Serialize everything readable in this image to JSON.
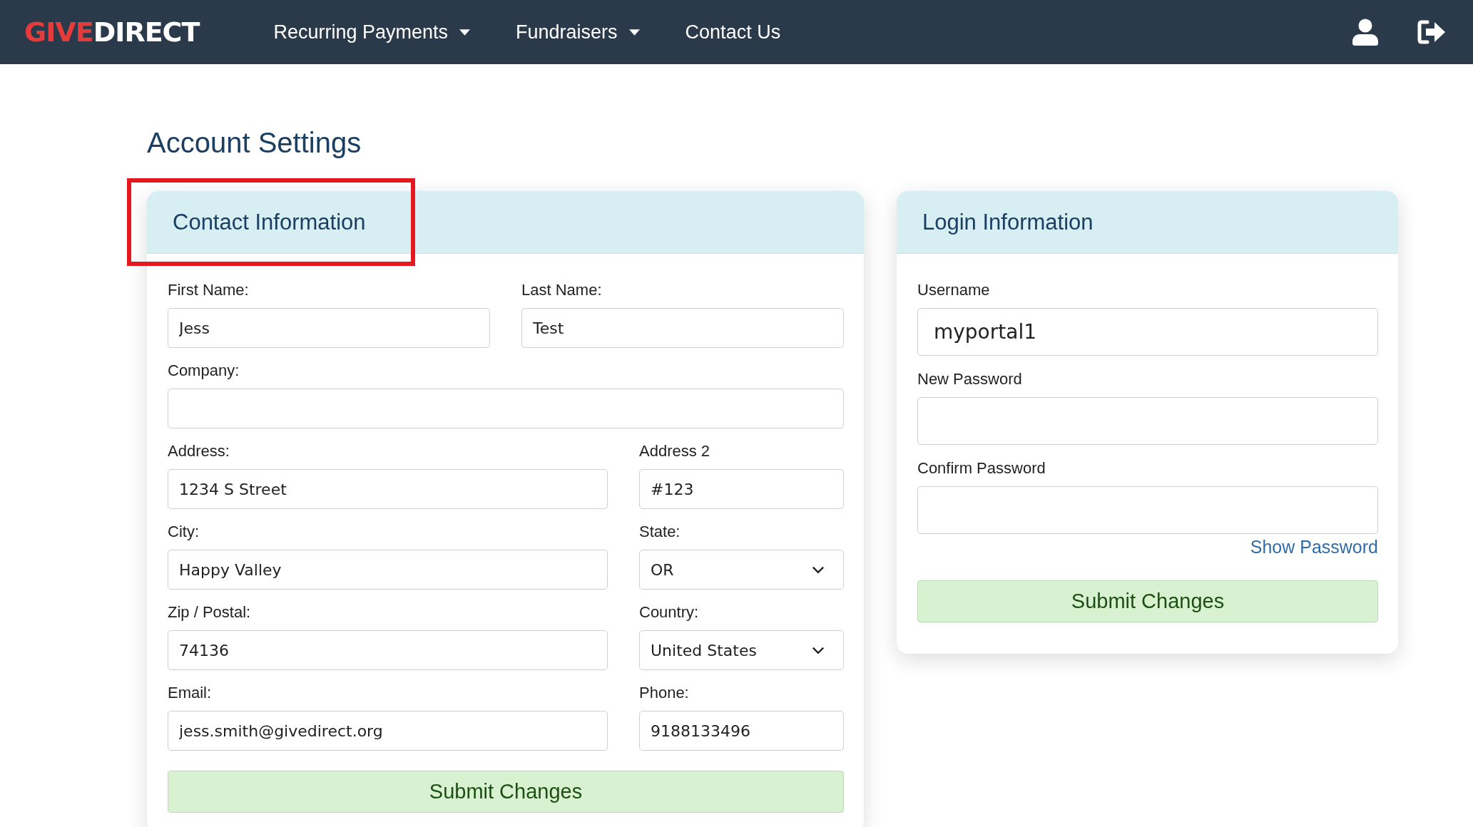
{
  "navbar": {
    "logo": {
      "accent": "GIVE",
      "rest": "DIRECT"
    },
    "items": [
      {
        "label": "Recurring Payments",
        "dropdown": true
      },
      {
        "label": "Fundraisers",
        "dropdown": true
      },
      {
        "label": "Contact Us",
        "dropdown": false
      }
    ]
  },
  "page_title": "Account Settings",
  "contact_card": {
    "title": "Contact Information",
    "highlighted": true,
    "rows": [
      {
        "kind": "halves",
        "fields": [
          {
            "label": "First Name:",
            "kind": "text",
            "value": "Jess"
          },
          {
            "label": "Last Name:",
            "kind": "text",
            "value": "Test"
          }
        ]
      },
      {
        "kind": "full",
        "fields": [
          {
            "label": "Company:",
            "kind": "text"
          }
        ]
      },
      {
        "kind": "wide-narrow",
        "fields": [
          {
            "label": "Address:",
            "kind": "text",
            "value": "1234 S Street"
          },
          {
            "label": "Address 2",
            "kind": "text",
            "value": "#123"
          }
        ]
      },
      {
        "kind": "wide-narrow",
        "fields": [
          {
            "label": "City:",
            "kind": "text",
            "value": "Happy Valley"
          },
          {
            "label": "State:",
            "kind": "select",
            "value": "OR"
          }
        ]
      },
      {
        "kind": "wide-narrow",
        "fields": [
          {
            "label": "Zip / Postal:",
            "kind": "text",
            "value": "74136"
          },
          {
            "label": "Country:",
            "kind": "select",
            "value": "United States"
          }
        ]
      },
      {
        "kind": "wide-narrow",
        "fields": [
          {
            "label": "Email:",
            "kind": "text",
            "value": "jess.smith@givedirect.org"
          },
          {
            "label": "Phone:",
            "kind": "text",
            "value": "9188133496"
          }
        ]
      }
    ],
    "submit": "Submit Changes"
  },
  "login_card": {
    "title": "Login Information",
    "highlighted": false,
    "fields": [
      {
        "label": "Username",
        "value": "myportal1"
      },
      {
        "label": "New Password"
      },
      {
        "label": "Confirm Password"
      }
    ],
    "show_password": "Show Password",
    "submit": "Submit Changes"
  }
}
